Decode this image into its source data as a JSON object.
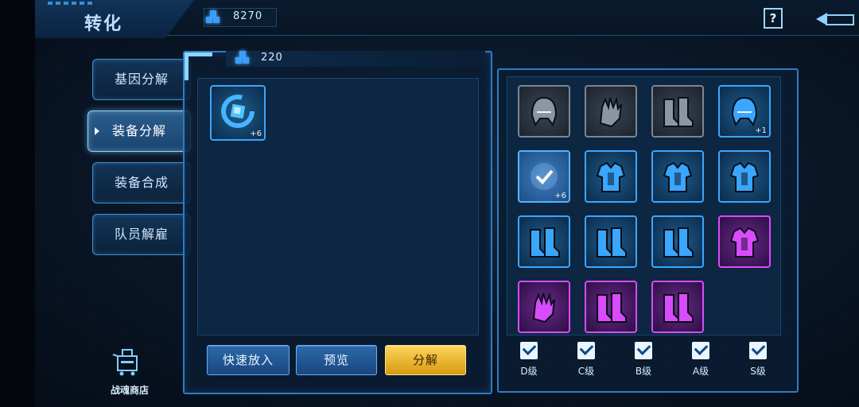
{
  "header": {
    "title": "转化",
    "currency_value": "8270"
  },
  "tabs": [
    {
      "label": "基因分解",
      "active": false
    },
    {
      "label": "装备分解",
      "active": true
    },
    {
      "label": "装备合成",
      "active": false
    },
    {
      "label": "队员解雇",
      "active": false
    }
  ],
  "shop": {
    "label": "战魂商店"
  },
  "left_panel": {
    "reward_count": "220",
    "slot": {
      "icon": "blue-core-item-icon",
      "level": "+6"
    },
    "buttons": {
      "quick_add": "快速放入",
      "preview": "预览",
      "decompose": "分解"
    }
  },
  "inventory": {
    "rows": [
      [
        {
          "rarity": "grey",
          "icon": "helmet-icon",
          "level": ""
        },
        {
          "rarity": "grey",
          "icon": "glove-icon",
          "level": ""
        },
        {
          "rarity": "grey",
          "icon": "boots-icon",
          "level": ""
        },
        {
          "rarity": "blue",
          "icon": "helmet-icon",
          "level": "+1"
        }
      ],
      [
        {
          "rarity": "selected",
          "icon": "checkmark-icon",
          "level": "+6"
        },
        {
          "rarity": "blue",
          "icon": "armor-icon",
          "level": ""
        },
        {
          "rarity": "blue",
          "icon": "armor-icon",
          "level": ""
        },
        {
          "rarity": "blue",
          "icon": "armor-icon",
          "level": ""
        }
      ],
      [
        {
          "rarity": "blue",
          "icon": "boots-icon",
          "level": ""
        },
        {
          "rarity": "blue",
          "icon": "boots-icon",
          "level": ""
        },
        {
          "rarity": "blue",
          "icon": "boots-icon",
          "level": ""
        },
        {
          "rarity": "purple",
          "icon": "armor-icon",
          "level": ""
        }
      ],
      [
        {
          "rarity": "purple",
          "icon": "glove-icon",
          "level": ""
        },
        {
          "rarity": "purple",
          "icon": "boots-icon",
          "level": ""
        },
        {
          "rarity": "purple",
          "icon": "boots-icon",
          "level": ""
        }
      ]
    ]
  },
  "grade_filters": [
    {
      "label": "D级",
      "checked": true
    },
    {
      "label": "C级",
      "checked": true
    },
    {
      "label": "B级",
      "checked": true
    },
    {
      "label": "A级",
      "checked": true
    },
    {
      "label": "S级",
      "checked": true
    }
  ],
  "colors": {
    "accent": "#3aa7ff",
    "gold": "#ffd45a",
    "purple_rarity": "#d94bff",
    "blue_rarity": "#3aa7ff",
    "grey_rarity": "#7a8694"
  }
}
